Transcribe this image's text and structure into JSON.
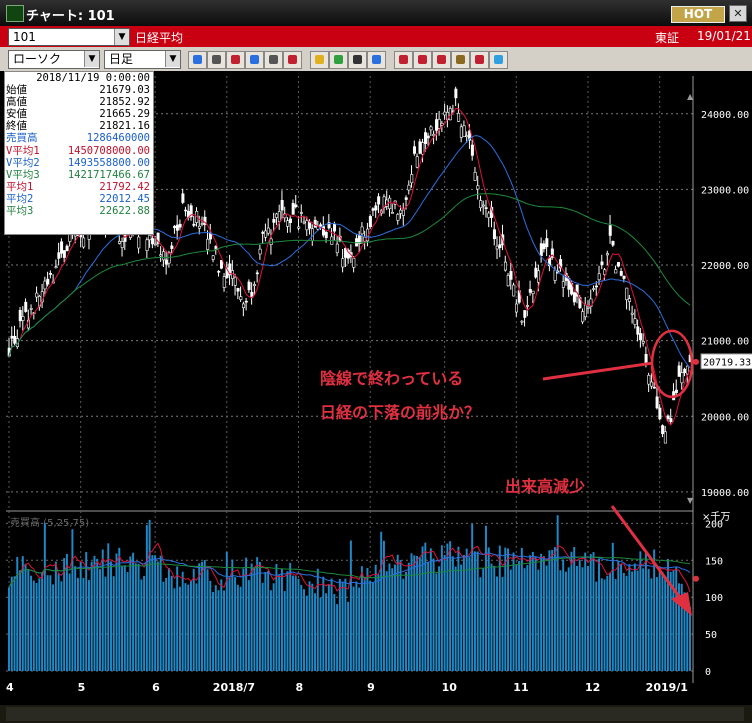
{
  "window": {
    "title": "チャート: 101",
    "hot_label": "HOT",
    "close_label": "✕"
  },
  "infobar": {
    "symbol": "101",
    "name": "日経平均",
    "exchange": "東証",
    "date": "19/01/21"
  },
  "toolbar": {
    "chart_type": "ローソク",
    "period": "日足",
    "tools": [
      "zoom-icon",
      "crosshair-icon",
      "candle-icon",
      "lens-icon",
      "grid-icon",
      "bars-icon",
      "alert-icon",
      "pen-icon",
      "cursor-icon",
      "arrow-icon",
      "pair-icon",
      "pair2-icon",
      "all-icon",
      "settings-icon",
      "wrench-icon",
      "palette-icon"
    ]
  },
  "ohlc_panel": {
    "date": "2018/11/19 0:00:00",
    "rows": [
      {
        "label": "始値",
        "value": "21679.03",
        "color": "#000000"
      },
      {
        "label": "高値",
        "value": "21852.92",
        "color": "#000000"
      },
      {
        "label": "安値",
        "value": "21665.29",
        "color": "#000000"
      },
      {
        "label": "終値",
        "value": "21821.16",
        "color": "#000000"
      },
      {
        "label": "売買高",
        "value": "1286460000",
        "color": "#1a5fc8"
      },
      {
        "label": "V平均1",
        "value": "1450708000.00",
        "color": "#c0102a"
      },
      {
        "label": "V平均2",
        "value": "1493558800.00",
        "color": "#1a5fc8"
      },
      {
        "label": "V平均3",
        "value": "1421717466.67",
        "color": "#208040"
      },
      {
        "label": "平均1",
        "value": "21792.42",
        "color": "#c0102a"
      },
      {
        "label": "平均2",
        "value": "22012.45",
        "color": "#1a5fc8"
      },
      {
        "label": "平均3",
        "value": "22622.88",
        "color": "#208040"
      }
    ]
  },
  "annotations": {
    "line1": "陰線で終わっている",
    "line2": "日経の下落の前兆か？",
    "line3": "出来高減少"
  },
  "chart_data": {
    "type": "candlestick",
    "price_axis": {
      "ticks": [
        "24000.00",
        "23000.00",
        "22000.00",
        "21000.00",
        "20000.00",
        "19000.00"
      ],
      "ylim": [
        18800,
        24500
      ]
    },
    "last_price_label": "20719.33",
    "volume_panel": {
      "label": "売買高 (5,25,75)",
      "unit": "×千万",
      "ticks": [
        "200",
        "150",
        "100",
        "50",
        "0"
      ],
      "ylim": [
        0,
        210
      ]
    },
    "x_tick_labels": [
      "4",
      "5",
      "6",
      "2018/7",
      "8",
      "9",
      "10",
      "11",
      "12",
      "2019/1"
    ],
    "price_anchors": [
      [
        0,
        20900
      ],
      [
        8,
        21400
      ],
      [
        15,
        21800
      ],
      [
        22,
        22300
      ],
      [
        28,
        22500
      ],
      [
        33,
        22600
      ],
      [
        40,
        22400
      ],
      [
        46,
        22500
      ],
      [
        52,
        22400
      ],
      [
        57,
        22000
      ],
      [
        61,
        22500
      ],
      [
        64,
        22800
      ],
      [
        70,
        22500
      ],
      [
        76,
        22000
      ],
      [
        81,
        21900
      ],
      [
        85,
        21500
      ],
      [
        88,
        21700
      ],
      [
        92,
        22300
      ],
      [
        98,
        22600
      ],
      [
        104,
        22650
      ],
      [
        110,
        22550
      ],
      [
        118,
        22400
      ],
      [
        124,
        22000
      ],
      [
        128,
        22400
      ],
      [
        134,
        22700
      ],
      [
        138,
        22900
      ],
      [
        142,
        22600
      ],
      [
        146,
        23300
      ],
      [
        150,
        23650
      ],
      [
        154,
        23850
      ],
      [
        158,
        24000
      ],
      [
        162,
        24150
      ],
      [
        166,
        23700
      ],
      [
        170,
        23100
      ],
      [
        174,
        22600
      ],
      [
        178,
        22300
      ],
      [
        182,
        21800
      ],
      [
        186,
        21300
      ],
      [
        190,
        21700
      ],
      [
        194,
        22200
      ],
      [
        198,
        22000
      ],
      [
        202,
        21700
      ],
      [
        206,
        21500
      ],
      [
        210,
        21500
      ],
      [
        214,
        21800
      ],
      [
        218,
        22300
      ],
      [
        222,
        21800
      ],
      [
        226,
        21400
      ],
      [
        230,
        20900
      ],
      [
        234,
        20300
      ],
      [
        237,
        19650
      ],
      [
        239,
        19900
      ],
      [
        241,
        20200
      ],
      [
        243,
        20450
      ],
      [
        245,
        20600
      ],
      [
        247,
        20719
      ]
    ],
    "volume_anchors": [
      [
        0,
        135
      ],
      [
        20,
        140
      ],
      [
        40,
        150
      ],
      [
        60,
        132
      ],
      [
        75,
        128
      ],
      [
        90,
        135
      ],
      [
        110,
        120
      ],
      [
        120,
        110
      ],
      [
        130,
        130
      ],
      [
        145,
        150
      ],
      [
        160,
        155
      ],
      [
        170,
        140
      ],
      [
        180,
        150
      ],
      [
        195,
        148
      ],
      [
        210,
        140
      ],
      [
        220,
        145
      ],
      [
        230,
        155
      ],
      [
        240,
        130
      ],
      [
        247,
        100
      ]
    ],
    "ma_periods": [
      5,
      25,
      75
    ],
    "series": [
      {
        "name": "平均1",
        "color": "#e0103a"
      },
      {
        "name": "平均2",
        "color": "#2a6fe0"
      },
      {
        "name": "平均3",
        "color": "#1d8a3a"
      }
    ]
  }
}
